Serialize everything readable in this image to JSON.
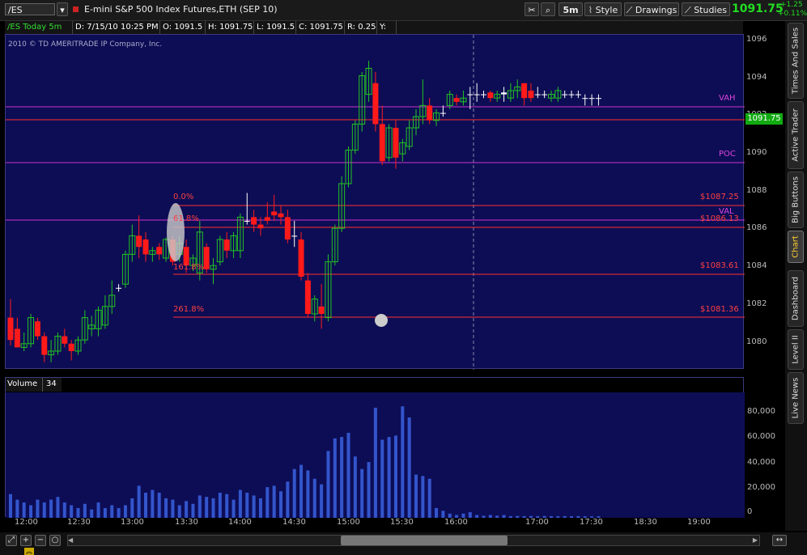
{
  "toolbar": {
    "symbol_value": "/ES",
    "instrument": "E-mini S&P 500 Index Futures,ETH (SEP 10)",
    "timeframe": "5m",
    "style_label": "Style",
    "drawings_label": "Drawings",
    "studies_label": "Studies",
    "last_price": "1091.75",
    "net_change": "+1.25",
    "pct_change": "+0.11%"
  },
  "infobar": {
    "chart_name": "/ES Today 5m",
    "date": "D: 7/15/10 10:25 PM",
    "open": "O: 1091.5",
    "high": "H: 1091.75",
    "low": "L: 1091.5",
    "close": "C: 1091.75",
    "range": "R: 0.25",
    "y": "Y:"
  },
  "copyright": "2010 © TD AMERITRADE IP Company, Inc.",
  "price_axis": {
    "ticks": [
      "1096",
      "1094",
      "1092",
      "1090",
      "1088",
      "1086",
      "1084",
      "1082",
      "1080"
    ],
    "current_price_tag": "1091.75"
  },
  "annotations": {
    "vah": "VAH",
    "poc": "POC",
    "val": "VAL",
    "fib_0": "0.0%",
    "fib_618": "61.8%",
    "fib_1618": "161.8%",
    "fib_2618": "261.8%",
    "fib_0_price": "$1087.25",
    "fib_618_price": "$1086.13",
    "fib_1618_price": "$1083.61",
    "fib_2618_price": "$1081.36"
  },
  "volume": {
    "label": "Volume",
    "value": "34",
    "axis_ticks": [
      "80,000",
      "60,000",
      "40,000",
      "20,000",
      "0"
    ]
  },
  "time_axis": [
    "12:00",
    "12:30",
    "13:00",
    "13:30",
    "14:00",
    "14:30",
    "15:00",
    "15:30",
    "16:00",
    "17:00",
    "17:30",
    "18:30",
    "19:00"
  ],
  "side_tabs": [
    "Times And Sales",
    "Active Trader",
    "Big Buttons",
    "Chart",
    "Dashboard",
    "Level II",
    "Live News"
  ],
  "colors": {
    "panel_bg": "#0d0d55",
    "up_candle": "#22c422",
    "down_candle": "#ff1a1a",
    "vah_poc_val": "#cc33cc",
    "fib_line": "#ff3030",
    "volume_bar": "#3355cc",
    "price_tag": "#11aa11"
  },
  "chart_data": {
    "type": "candlestick",
    "price_ylim": [
      1079,
      1097
    ],
    "candles": [
      {
        "o": 1081.8,
        "h": 1082.8,
        "l": 1080.3,
        "c": 1080.6
      },
      {
        "o": 1081.2,
        "h": 1081.8,
        "l": 1080.2,
        "c": 1080.2
      },
      {
        "o": 1080.2,
        "h": 1081.0,
        "l": 1080.0,
        "c": 1080.4
      },
      {
        "o": 1080.4,
        "h": 1082.0,
        "l": 1080.2,
        "c": 1081.8
      },
      {
        "o": 1081.6,
        "h": 1081.8,
        "l": 1080.6,
        "c": 1080.8
      },
      {
        "o": 1080.8,
        "h": 1081.0,
        "l": 1079.4,
        "c": 1079.8
      },
      {
        "o": 1079.8,
        "h": 1080.6,
        "l": 1079.4,
        "c": 1080.0
      },
      {
        "o": 1080.0,
        "h": 1081.0,
        "l": 1079.8,
        "c": 1080.8
      },
      {
        "o": 1080.8,
        "h": 1081.2,
        "l": 1080.2,
        "c": 1080.4
      },
      {
        "o": 1080.4,
        "h": 1080.6,
        "l": 1079.5,
        "c": 1080.0
      },
      {
        "o": 1080.0,
        "h": 1080.8,
        "l": 1079.8,
        "c": 1080.6
      },
      {
        "o": 1080.6,
        "h": 1082.2,
        "l": 1080.4,
        "c": 1081.8
      },
      {
        "o": 1081.2,
        "h": 1081.9,
        "l": 1080.8,
        "c": 1081.4
      },
      {
        "o": 1081.2,
        "h": 1082.4,
        "l": 1080.8,
        "c": 1082.2
      },
      {
        "o": 1081.4,
        "h": 1083.0,
        "l": 1081.2,
        "c": 1082.4
      },
      {
        "o": 1082.4,
        "h": 1083.8,
        "l": 1082.0,
        "c": 1083.0
      },
      {
        "o": 1083.4,
        "h": 1083.6,
        "l": 1083.2,
        "c": 1083.4
      },
      {
        "o": 1083.6,
        "h": 1085.4,
        "l": 1083.4,
        "c": 1085.2
      },
      {
        "o": 1085.2,
        "h": 1086.8,
        "l": 1084.8,
        "c": 1086.2
      },
      {
        "o": 1086.2,
        "h": 1087.3,
        "l": 1085.0,
        "c": 1085.6
      },
      {
        "o": 1086.0,
        "h": 1086.4,
        "l": 1084.8,
        "c": 1085.2
      },
      {
        "o": 1085.2,
        "h": 1085.6,
        "l": 1084.8,
        "c": 1085.4
      },
      {
        "o": 1085.6,
        "h": 1085.8,
        "l": 1084.9,
        "c": 1085.2
      },
      {
        "o": 1085.0,
        "h": 1086.1,
        "l": 1084.8,
        "c": 1086.0
      },
      {
        "o": 1086.0,
        "h": 1086.2,
        "l": 1084.6,
        "c": 1084.8
      },
      {
        "o": 1085.2,
        "h": 1086.2,
        "l": 1084.8,
        "c": 1085.8
      },
      {
        "o": 1085.6,
        "h": 1086.0,
        "l": 1084.2,
        "c": 1084.6
      },
      {
        "o": 1084.6,
        "h": 1085.2,
        "l": 1084.3,
        "c": 1085.0
      },
      {
        "o": 1084.2,
        "h": 1087.0,
        "l": 1083.8,
        "c": 1086.4
      },
      {
        "o": 1085.6,
        "h": 1085.8,
        "l": 1084.2,
        "c": 1084.4
      },
      {
        "o": 1084.4,
        "h": 1085.0,
        "l": 1083.6,
        "c": 1084.6
      },
      {
        "o": 1084.8,
        "h": 1086.2,
        "l": 1084.6,
        "c": 1086.0
      },
      {
        "o": 1086.0,
        "h": 1086.4,
        "l": 1085.0,
        "c": 1085.4
      },
      {
        "o": 1085.4,
        "h": 1086.4,
        "l": 1085.0,
        "c": 1086.2
      },
      {
        "o": 1085.4,
        "h": 1087.4,
        "l": 1085.0,
        "c": 1087.2
      },
      {
        "o": 1087.0,
        "h": 1088.5,
        "l": 1086.8,
        "c": 1087.0
      },
      {
        "o": 1087.2,
        "h": 1087.6,
        "l": 1086.4,
        "c": 1086.8
      },
      {
        "o": 1086.8,
        "h": 1087.2,
        "l": 1086.2,
        "c": 1086.6
      },
      {
        "o": 1087.2,
        "h": 1088.0,
        "l": 1086.8,
        "c": 1087.0
      },
      {
        "o": 1087.5,
        "h": 1088.4,
        "l": 1087.0,
        "c": 1087.3
      },
      {
        "o": 1087.4,
        "h": 1087.8,
        "l": 1086.8,
        "c": 1087.2
      },
      {
        "o": 1087.2,
        "h": 1087.6,
        "l": 1085.8,
        "c": 1086.0
      },
      {
        "o": 1086.2,
        "h": 1087.0,
        "l": 1085.6,
        "c": 1086.2
      },
      {
        "o": 1086.0,
        "h": 1086.4,
        "l": 1083.8,
        "c": 1084.0
      },
      {
        "o": 1083.8,
        "h": 1084.2,
        "l": 1081.8,
        "c": 1082.0
      },
      {
        "o": 1082.0,
        "h": 1083.0,
        "l": 1081.6,
        "c": 1082.8
      },
      {
        "o": 1082.4,
        "h": 1083.6,
        "l": 1081.2,
        "c": 1082.0
      },
      {
        "o": 1081.8,
        "h": 1085.2,
        "l": 1081.6,
        "c": 1084.8
      },
      {
        "o": 1084.8,
        "h": 1086.8,
        "l": 1084.6,
        "c": 1086.6
      },
      {
        "o": 1086.6,
        "h": 1089.4,
        "l": 1086.4,
        "c": 1089.0
      },
      {
        "o": 1089.0,
        "h": 1091.0,
        "l": 1088.8,
        "c": 1090.8
      },
      {
        "o": 1090.8,
        "h": 1092.4,
        "l": 1090.6,
        "c": 1092.2
      },
      {
        "o": 1092.2,
        "h": 1095.0,
        "l": 1091.8,
        "c": 1094.8
      },
      {
        "o": 1093.8,
        "h": 1095.6,
        "l": 1093.4,
        "c": 1095.2
      },
      {
        "o": 1094.4,
        "h": 1095.0,
        "l": 1091.8,
        "c": 1092.2
      },
      {
        "o": 1092.2,
        "h": 1093.2,
        "l": 1090.0,
        "c": 1090.2
      },
      {
        "o": 1090.4,
        "h": 1092.2,
        "l": 1090.2,
        "c": 1092.0
      },
      {
        "o": 1092.0,
        "h": 1092.4,
        "l": 1089.8,
        "c": 1090.4
      },
      {
        "o": 1090.6,
        "h": 1091.4,
        "l": 1090.2,
        "c": 1091.2
      },
      {
        "o": 1091.0,
        "h": 1092.4,
        "l": 1090.8,
        "c": 1092.0
      },
      {
        "o": 1092.0,
        "h": 1093.0,
        "l": 1091.6,
        "c": 1092.6
      },
      {
        "o": 1092.6,
        "h": 1094.6,
        "l": 1092.2,
        "c": 1093.2
      },
      {
        "o": 1093.2,
        "h": 1093.6,
        "l": 1092.2,
        "c": 1092.4
      },
      {
        "o": 1092.4,
        "h": 1093.0,
        "l": 1092.1,
        "c": 1092.8
      },
      {
        "o": 1092.8,
        "h": 1093.2,
        "l": 1092.6,
        "c": 1092.8
      },
      {
        "o": 1093.2,
        "h": 1094.0,
        "l": 1093.0,
        "c": 1093.8
      },
      {
        "o": 1093.6,
        "h": 1093.8,
        "l": 1093.2,
        "c": 1093.4
      },
      {
        "o": 1093.4,
        "h": 1094.0,
        "l": 1093.2,
        "c": 1093.6
      },
      {
        "o": 1093.8,
        "h": 1094.2,
        "l": 1093.0,
        "c": 1093.8
      },
      {
        "o": 1093.8,
        "h": 1094.4,
        "l": 1093.4,
        "c": 1093.8
      },
      {
        "o": 1093.8,
        "h": 1094.0,
        "l": 1093.6,
        "c": 1093.8
      },
      {
        "o": 1093.9,
        "h": 1094.0,
        "l": 1093.4,
        "c": 1093.6
      },
      {
        "o": 1093.6,
        "h": 1094.0,
        "l": 1093.4,
        "c": 1093.8
      },
      {
        "o": 1093.8,
        "h": 1094.2,
        "l": 1093.4,
        "c": 1093.9
      },
      {
        "o": 1093.6,
        "h": 1094.4,
        "l": 1093.4,
        "c": 1094.0
      },
      {
        "o": 1094.0,
        "h": 1094.6,
        "l": 1093.6,
        "c": 1094.2
      },
      {
        "o": 1094.4,
        "h": 1094.2,
        "l": 1093.2,
        "c": 1093.6
      },
      {
        "o": 1094.0,
        "h": 1094.4,
        "l": 1093.4,
        "c": 1093.6
      },
      {
        "o": 1093.8,
        "h": 1094.2,
        "l": 1093.6,
        "c": 1093.8
      },
      {
        "o": 1093.8,
        "h": 1094.0,
        "l": 1093.6,
        "c": 1093.8
      },
      {
        "o": 1093.6,
        "h": 1094.0,
        "l": 1093.4,
        "c": 1093.8
      },
      {
        "o": 1093.6,
        "h": 1094.2,
        "l": 1093.4,
        "c": 1094.0
      },
      {
        "o": 1093.8,
        "h": 1094.0,
        "l": 1093.6,
        "c": 1093.8
      },
      {
        "o": 1093.8,
        "h": 1094.0,
        "l": 1093.6,
        "c": 1093.8
      },
      {
        "o": 1093.8,
        "h": 1094.0,
        "l": 1093.6,
        "c": 1093.8
      },
      {
        "o": 1093.6,
        "h": 1093.8,
        "l": 1093.2,
        "c": 1093.6
      },
      {
        "o": 1093.6,
        "h": 1093.8,
        "l": 1093.2,
        "c": 1093.6
      },
      {
        "o": 1093.6,
        "h": 1093.8,
        "l": 1093.2,
        "c": 1093.6
      }
    ],
    "volume_ylim": [
      0,
      90000
    ],
    "volumes": [
      17000,
      13000,
      11000,
      9000,
      13000,
      11000,
      13000,
      15000,
      11000,
      9000,
      7000,
      10000,
      6000,
      11000,
      7000,
      9000,
      7000,
      9000,
      14000,
      23000,
      18000,
      20000,
      18000,
      14000,
      13000,
      9000,
      12000,
      10000,
      16000,
      15000,
      14000,
      18000,
      17000,
      13000,
      20000,
      18000,
      16000,
      14000,
      22000,
      23000,
      19000,
      26000,
      35000,
      38000,
      34000,
      28000,
      24000,
      48000,
      57000,
      58000,
      61000,
      44000,
      35000,
      40000,
      79000,
      56000,
      58000,
      59000,
      80000,
      72000,
      31000,
      30000,
      28000,
      7000,
      5000,
      3000,
      2000,
      3000,
      4000,
      2000,
      1500,
      2000,
      1500,
      2000,
      1200,
      1300,
      1200,
      1300,
      1200,
      1300,
      1200,
      1100,
      1200,
      1100,
      1200,
      1100,
      1000,
      1100
    ]
  }
}
